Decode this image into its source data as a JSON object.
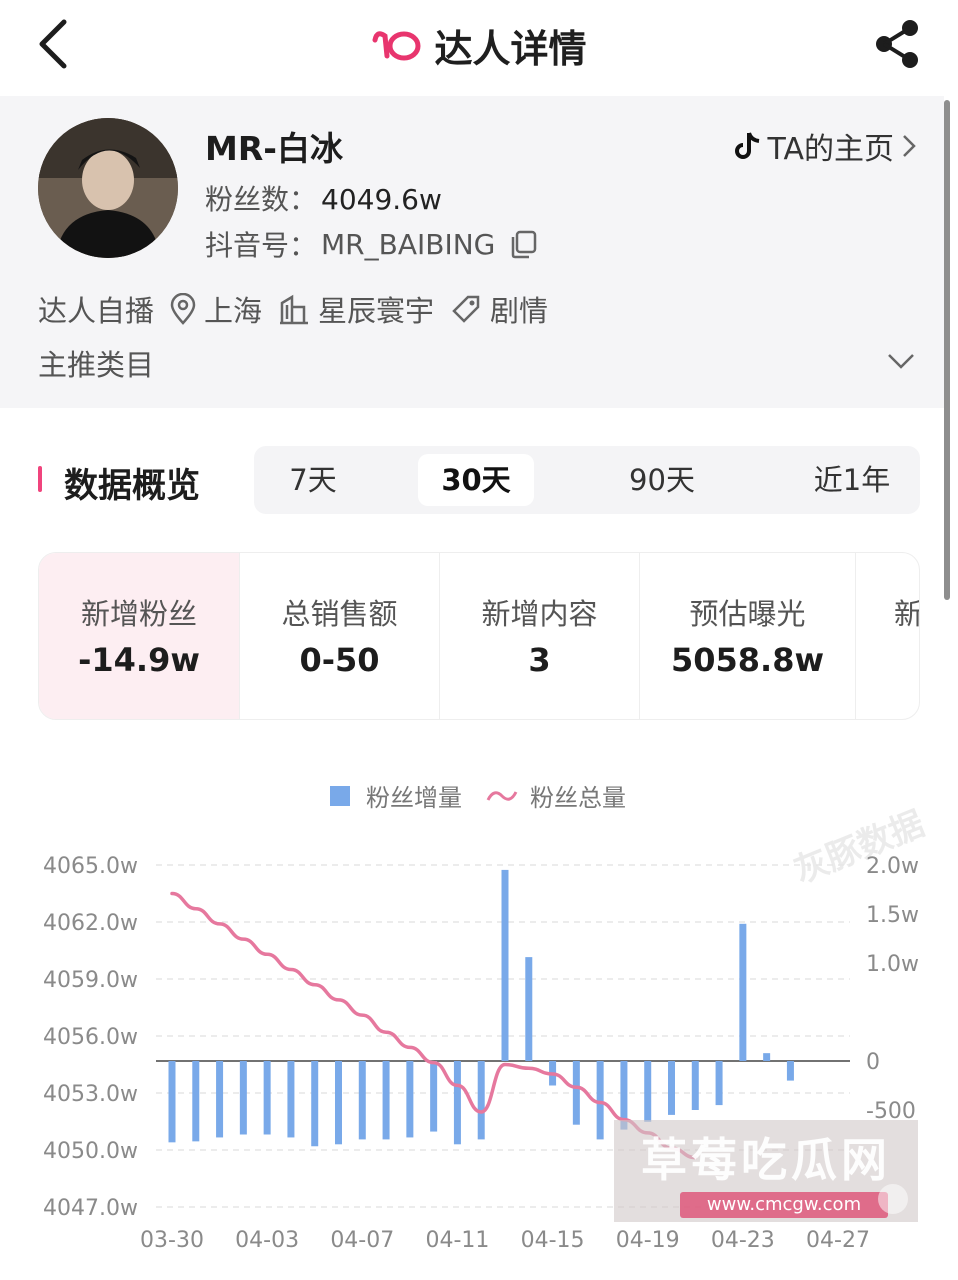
{
  "header": {
    "title": "达人详情",
    "logo_icon": "pink-app-logo-icon",
    "back_icon": "back-arrow-icon",
    "share_icon": "share-icon"
  },
  "profile": {
    "name": "MR-白冰",
    "homepage_label": "TA的主页",
    "fans_label": "粉丝数：",
    "fans_value": "4049.6w",
    "douyin_label": "抖音号：",
    "douyin_value": "MR_BAIBING",
    "tags": [
      {
        "icon": "",
        "label": "达人自播"
      },
      {
        "icon": "location-pin-icon",
        "label": "上海"
      },
      {
        "icon": "building-icon",
        "label": "星辰寰宇"
      },
      {
        "icon": "tag-icon",
        "label": "剧情"
      }
    ],
    "category_label": "主推类目"
  },
  "overview": {
    "title": "数据概览",
    "periods": [
      "7天",
      "30天",
      "90天",
      "近1年"
    ],
    "active_period": "30天",
    "metrics": [
      {
        "label": "新增粉丝",
        "value": "-14.9w"
      },
      {
        "label": "总销售额",
        "value": "0-50"
      },
      {
        "label": "新增内容",
        "value": "3"
      },
      {
        "label": "预估曝光",
        "value": "5058.8w"
      },
      {
        "label": "新",
        "value": ""
      }
    ]
  },
  "legend": {
    "bar_label": "粉丝增量",
    "line_label": "粉丝总量"
  },
  "watermarks": {
    "faint": "灰豚数据",
    "badge": "草莓吃瓜网",
    "url": "www.cmcgw.com"
  },
  "colors": {
    "accent": "#f0447d",
    "bar": "#79a9e9",
    "line": "#e6789e"
  },
  "chart_data": {
    "type": "bar",
    "x": [
      "03-30",
      "03-31",
      "04-01",
      "04-02",
      "04-03",
      "04-04",
      "04-05",
      "04-06",
      "04-07",
      "04-08",
      "04-09",
      "04-10",
      "04-11",
      "04-12",
      "04-13",
      "04-14",
      "04-15",
      "04-16",
      "04-17",
      "04-18",
      "04-19",
      "04-20",
      "04-21",
      "04-22",
      "04-23",
      "04-24",
      "04-25",
      "04-26",
      "04-27"
    ],
    "x_tick_labels": [
      "03-30",
      "04-03",
      "04-07",
      "04-11",
      "04-15",
      "04-19",
      "04-23",
      "04-27"
    ],
    "series": [
      {
        "name": "粉丝增量",
        "type": "bar",
        "axis": "right",
        "values": [
          -0.83,
          -0.82,
          -0.78,
          -0.75,
          -0.75,
          -0.78,
          -0.87,
          -0.85,
          -0.8,
          -0.8,
          -0.78,
          -0.72,
          -0.85,
          -0.8,
          1.95,
          1.06,
          -0.25,
          -0.65,
          -0.8,
          -0.7,
          -0.62,
          -0.55,
          -0.5,
          -0.45,
          1.4,
          0.08,
          -0.2,
          0,
          0
        ]
      },
      {
        "name": "粉丝总量",
        "type": "line",
        "axis": "left",
        "values": [
          4063.5,
          4062.7,
          4061.9,
          4061.1,
          4060.3,
          4059.5,
          4058.7,
          4057.9,
          4057.1,
          4056.2,
          4055.4,
          4054.6,
          4053.4,
          4052.0,
          4054.5,
          4054.3,
          4054.0,
          4053.3,
          4052.5,
          4051.6,
          4050.9,
          4050.1,
          4049.6
        ]
      }
    ],
    "y_left": {
      "ticks": [
        "4065.0w",
        "4062.0w",
        "4059.0w",
        "4056.0w",
        "4053.0w",
        "4050.0w",
        "4047.0w"
      ],
      "min": 4047,
      "max": 4065
    },
    "y_right": {
      "ticks": [
        "2.0w",
        "1.5w",
        "1.0w",
        "0",
        "-500"
      ]
    },
    "grid": true,
    "legend_position": "top-center"
  }
}
